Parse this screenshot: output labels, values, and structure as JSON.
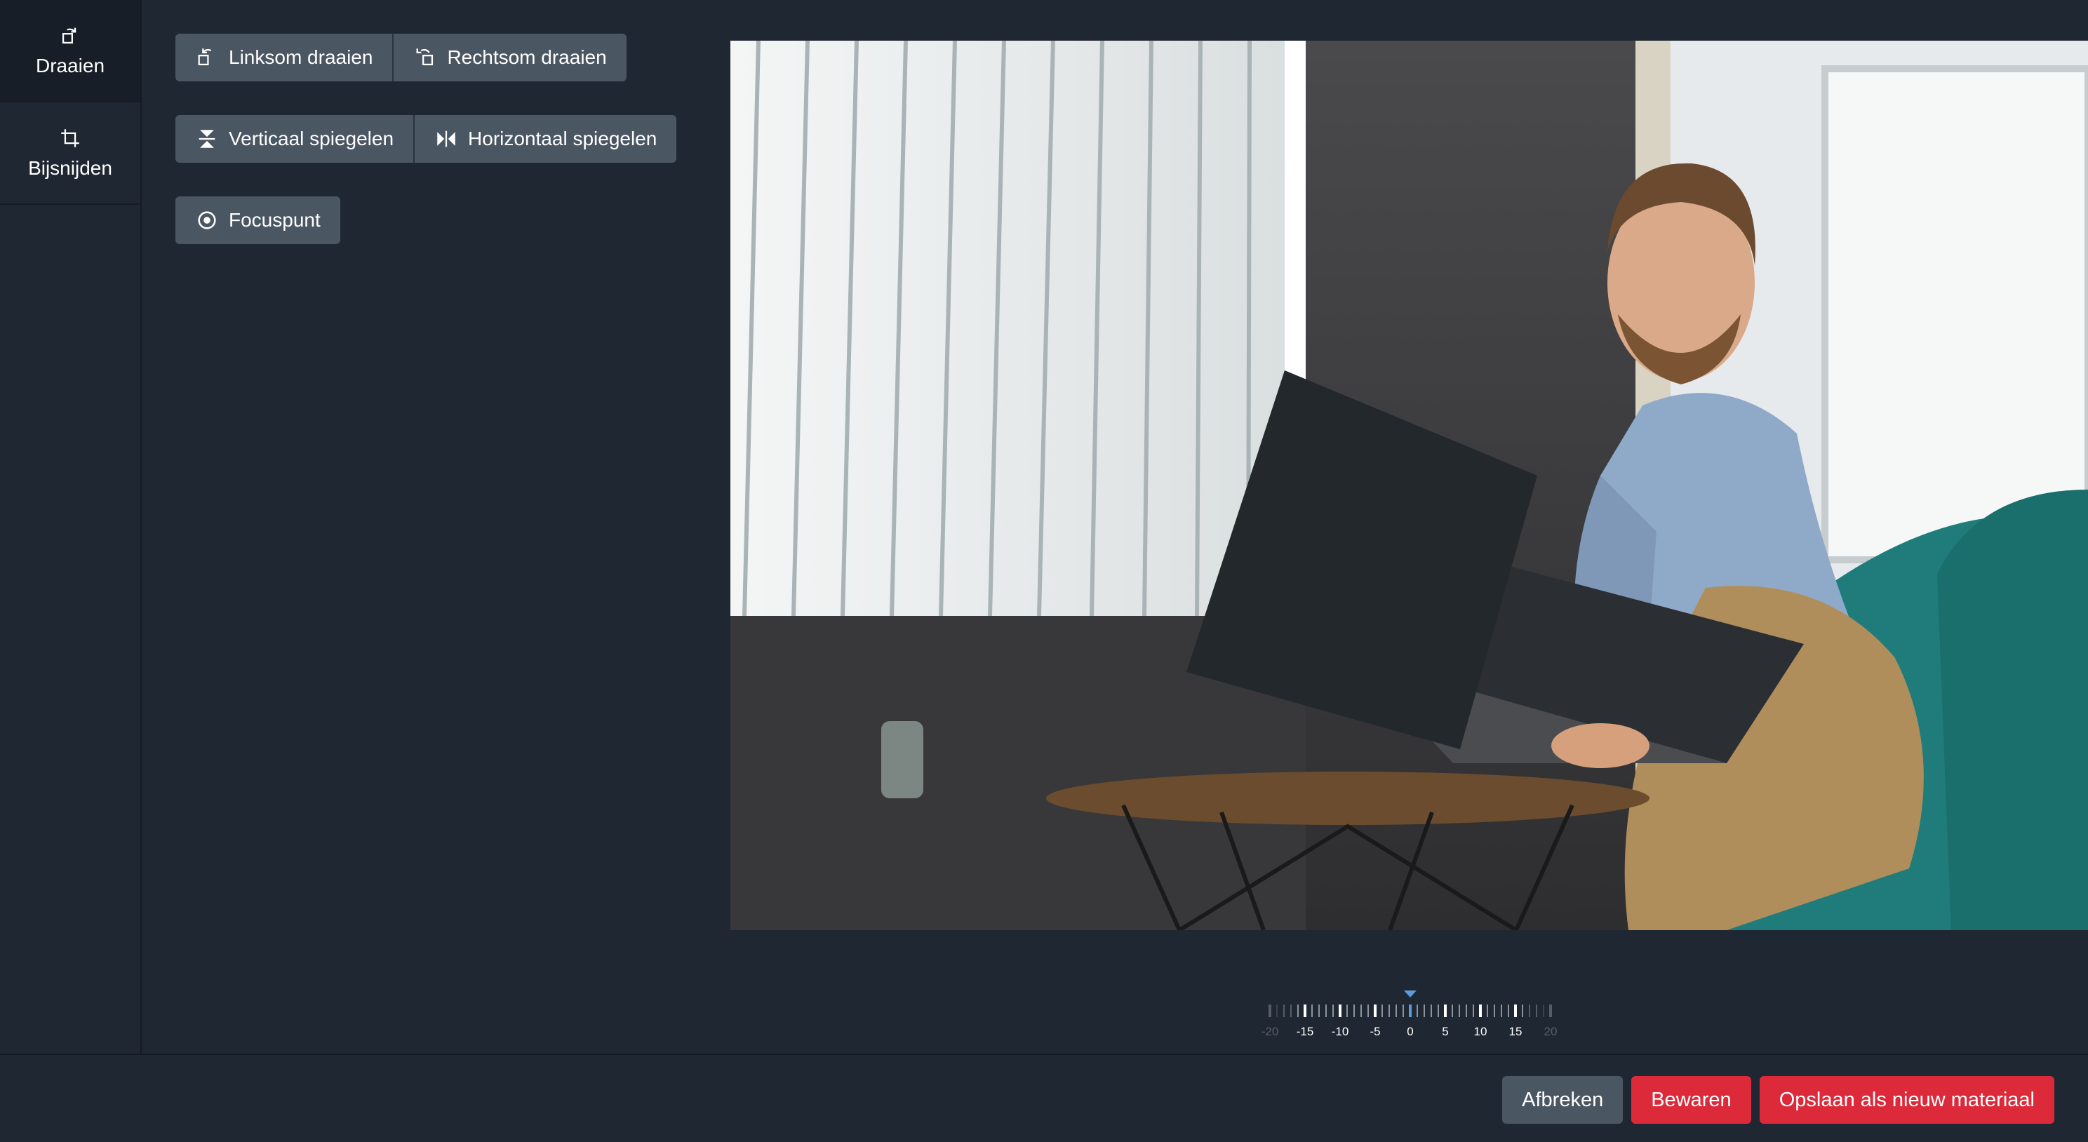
{
  "sidebar": {
    "items": [
      {
        "label": "Draaien",
        "icon": "rotate-icon",
        "active": true
      },
      {
        "label": "Bijsnijden",
        "icon": "crop-icon",
        "active": false
      }
    ]
  },
  "toolbar": {
    "rotate_left": "Linksom draaien",
    "rotate_right": "Rechtsom draaien",
    "flip_vertical": "Verticaal spiegelen",
    "flip_horizontal": "Horizontaal spiegelen",
    "focus_point": "Focuspunt"
  },
  "ruler": {
    "value": 0,
    "min": -20,
    "max": 20,
    "labels": [
      "-20",
      "-15",
      "-10",
      "-5",
      "0",
      "5",
      "10",
      "15",
      "20"
    ],
    "accent_color": "#5a9bd8"
  },
  "footer": {
    "cancel": "Afbreken",
    "save": "Bewaren",
    "save_as_new": "Opslaan als nieuw materiaal"
  },
  "colors": {
    "background": "#1f2732",
    "button": "#4b5663",
    "danger": "#dc2a3a"
  }
}
